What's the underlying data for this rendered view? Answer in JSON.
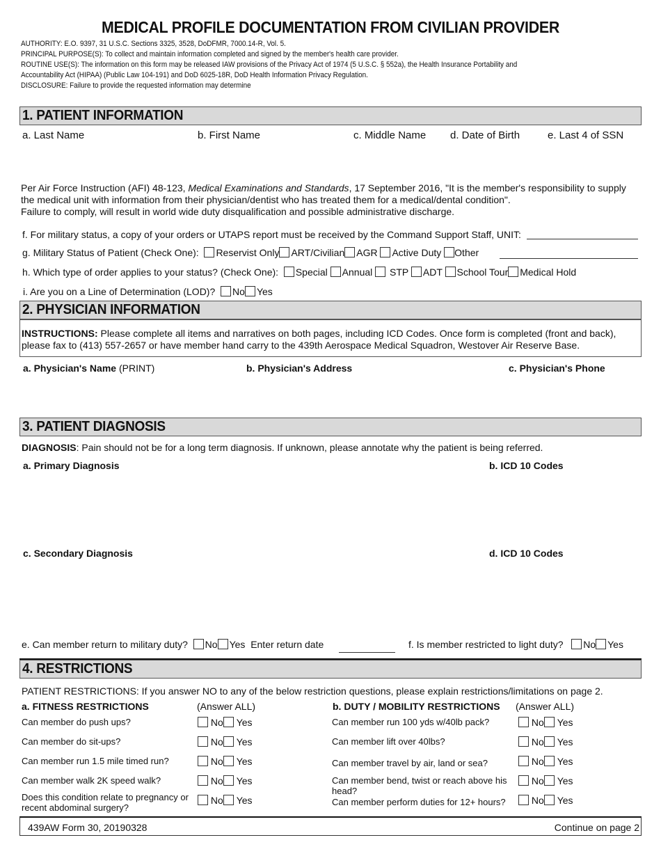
{
  "header": {
    "title": "MEDICAL PROFILE DOCUMENTATION  FROM CIVILIAN PROVIDER",
    "privacy": [
      "AUTHORITY:  E.O. 9397, 31 U.S.C. Sections 3325, 3528, DoDFMR, 7000.14-R, Vol. 5.",
      "PRINCIPAL PURPOSE(S):  To collect and maintain information completed and signed by the member's health care provider.",
      "ROUTINE USE(S):  The information on this form may be released IAW provisions of the Privacy Act of 1974 (5 U.S.C. § 552a), the Health Insurance Portability and",
      "Accountability Act (HIPAA) (Public Law 104-191) and DoD 6025-18R, DoD Health Information Privacy Regulation.",
      "DISCLOSURE:  Failure to provide the requested information may determine"
    ]
  },
  "section1": {
    "heading": "1.  PATIENT INFORMATION",
    "fields": [
      {
        "label": "a.  Last Name"
      },
      {
        "label": "b.  First Name"
      },
      {
        "label": "c.  Middle Name"
      },
      {
        "label": "d.  Date of Birth"
      },
      {
        "label": "e.  Last 4 of SSN"
      }
    ],
    "afi_part1": "Per Air Force Instruction (AFI) 48-123, ",
    "afi_italic": "Medical Examinations and Standards",
    "afi_part2": ", 17 September 2016, \"It is the member's responsibility to supply",
    "afi_line2": "the medical unit with information from their physician/dentist who has treated them for a medical/dental condition\".",
    "afi_line3": "Failure to comply, will result in world wide duty disqualification and possible administrative discharge.",
    "f_label": "f.  For military status, a copy of your orders or UTAPS report must be received by the Command Support Staff, UNIT:",
    "f_value": "",
    "g_label": "g.  Military Status of Patient (Check One):",
    "g_options": [
      "Reservist Only",
      "ART/Civilian",
      "AGR",
      "Active Duty",
      "Other"
    ],
    "g_other_value": "",
    "h_label": "h.  Which type of order applies to your status? (Check One):",
    "h_options": [
      "Special",
      "Annual",
      "STP",
      "ADT",
      "School Tour",
      "Medical Hold"
    ],
    "i_label": "i.  Are you on a Line of Determination (LOD)?",
    "i_options": [
      "No",
      "Yes"
    ]
  },
  "section2": {
    "heading": "2.  PHYSICIAN INFORMATION",
    "instr_bold": "INSTRUCTIONS:",
    "instr_line1": "  Please complete all items and narratives on both pages, including ICD Codes.  Once form is completed (front and back),",
    "instr_line2": "please fax to (413) 557-2657 or have member hand carry to the 439th Aerospace Medical Squadron, Westover Air Reserve Base.",
    "name_label": "a.  Physician's Name",
    "name_suffix": " (PRINT)",
    "address_label": "b.  Physician's Address",
    "phone_label": "c.  Physician's Phone"
  },
  "section3": {
    "heading": "3.  PATIENT DIAGNOSIS",
    "diag_bold": "DIAGNOSIS",
    "diag_text": ":  Pain should not be for a long term diagnosis.  If unknown, please annotate why the patient is being referred.",
    "primary_label": "a.  Primary Diagnosis",
    "icd_b_label": "b.  ICD 10 Codes",
    "secondary_label": "c.  Secondary Diagnosis",
    "icd_d_label": "d.  ICD 10 Codes",
    "e_label": "e.  Can member return to military duty?",
    "e_options": [
      "No",
      "Yes"
    ],
    "return_date_label": "Enter return date",
    "return_date_value": "",
    "f_label": "f.  Is member restricted to light duty?",
    "f_options": [
      "No",
      "Yes"
    ]
  },
  "section4": {
    "heading": "4.  RESTRICTIONS",
    "intro": "PATIENT RESTRICTIONS:   If you answer NO to any of the below restriction questions, please explain restrictions/limitations on page 2.",
    "fitness_heading": "a.  FITNESS RESTRICTIONS",
    "duty_heading": "b.  DUTY / MOBILITY RESTRICTIONS",
    "answer_all": "(Answer ALL)",
    "no_label": "No",
    "yes_label": "Yes",
    "fitness_questions": [
      "Can member do push ups?",
      "Can member do sit-ups?",
      "Can member run 1.5 mile timed run?",
      "Can member walk 2K speed walk?",
      "Does this condition relate to pregnancy or",
      "recent abdominal surgery?"
    ],
    "duty_questions": [
      "Can member run 100 yds w/40lb pack?",
      "Can member lift over 40lbs?",
      "Can member travel by air, land or sea?",
      "Can member bend, twist or reach above his",
      "head?",
      "Can member perform duties for 12+ hours?"
    ]
  },
  "footer": {
    "form_id": "439AW Form 30, 20190328",
    "continue": "Continue on page 2"
  }
}
